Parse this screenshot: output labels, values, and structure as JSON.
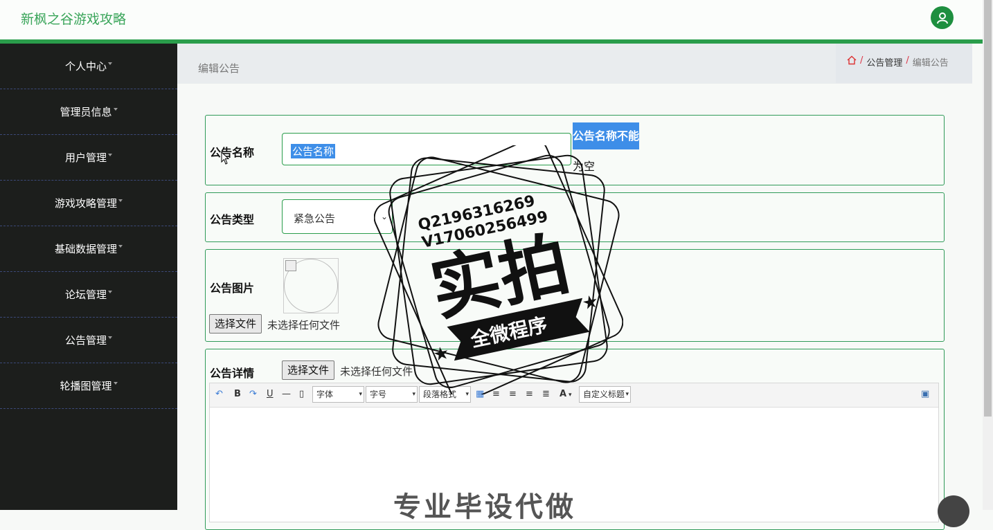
{
  "app": {
    "title": "新枫之谷游戏攻略"
  },
  "sidebar": {
    "items": [
      {
        "label": "个人中心"
      },
      {
        "label": "管理员信息"
      },
      {
        "label": "用户管理"
      },
      {
        "label": "游戏攻略管理"
      },
      {
        "label": "基础数据管理"
      },
      {
        "label": "论坛管理"
      },
      {
        "label": "公告管理"
      },
      {
        "label": "轮播图管理"
      }
    ]
  },
  "header": {
    "page_title": "编辑公告",
    "breadcrumb": [
      {
        "label": "公告管理"
      },
      {
        "label": "编辑公告"
      }
    ],
    "separator": "/"
  },
  "form": {
    "name": {
      "label": "公告名称",
      "value": "公告名称",
      "error_line1": "公告名称不能",
      "error_line2": "为空"
    },
    "type": {
      "label": "公告类型",
      "selected": "紧急公告"
    },
    "image": {
      "label": "公告图片",
      "button": "选择文件",
      "status": "未选择任何文件"
    },
    "detail": {
      "label": "公告详情",
      "button": "选择文件",
      "status": "未选择任何文件"
    }
  },
  "editor": {
    "font_label": "字体",
    "size_label": "字号",
    "format_label": "段落格式",
    "custom_title_label": "自定义标题",
    "bold": "B",
    "underline": "U",
    "font_color": "A"
  },
  "watermark": {
    "line1": "Q2196316269",
    "line2": "V17060256499",
    "big_text": "实拍",
    "banner_text": "全微程序",
    "bottom_text": "专业毕设代做"
  },
  "colors": {
    "accent": "#2a9d4b",
    "sidebar_bg": "#1c1e1c",
    "highlight": "#3e8ee8"
  }
}
